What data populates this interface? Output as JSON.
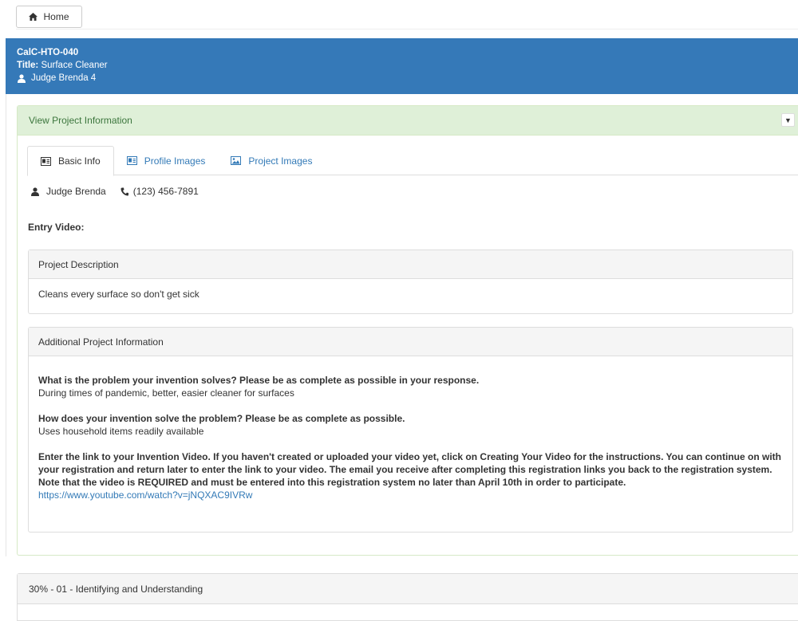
{
  "nav": {
    "home_label": "Home",
    "home_icon": "home-icon"
  },
  "header": {
    "code": "CalC-HTO-040",
    "title_label": "Title:",
    "title_value": "Surface Cleaner",
    "judge": "Judge Brenda 4",
    "background": "#3579b8"
  },
  "info_panel": {
    "heading": "View Project Information",
    "toggle_glyph": "▼"
  },
  "tabs": [
    {
      "label": "Basic Info",
      "icon": "id-card-icon"
    },
    {
      "label": "Profile Images",
      "icon": "id-card-icon"
    },
    {
      "label": "Project Images",
      "icon": "image-icon"
    }
  ],
  "contact": {
    "name": "Judge Brenda",
    "phone": "(123) 456-7891"
  },
  "entry_video_label": "Entry Video:",
  "description": {
    "heading": "Project Description",
    "body": "Cleans every surface so don't get sick"
  },
  "additional": {
    "heading": "Additional Project Information",
    "items": [
      {
        "question": "What is the problem your invention solves? Please be as complete as possible in your response.",
        "answer": "During times of pandemic, better, easier cleaner for surfaces"
      },
      {
        "question": "How does your invention solve the problem? Please be as complete as possible.",
        "answer": "Uses household items readily available"
      },
      {
        "question": "Enter the link to your Invention Video. If you haven't created or uploaded your video yet, click on Creating Your Video for the instructions. You can continue on with your registration and return later to enter the link to your video. The email you receive after completing this registration links you back to the registration system. Note that the video is REQUIRED and must be entered into this registration system no later than April 10th in order to participate.",
        "link": "https://www.youtube.com/watch?v=jNQXAC9IVRw"
      }
    ]
  },
  "scores": {
    "heading": "30% - 01 - Identifying and Understanding"
  }
}
